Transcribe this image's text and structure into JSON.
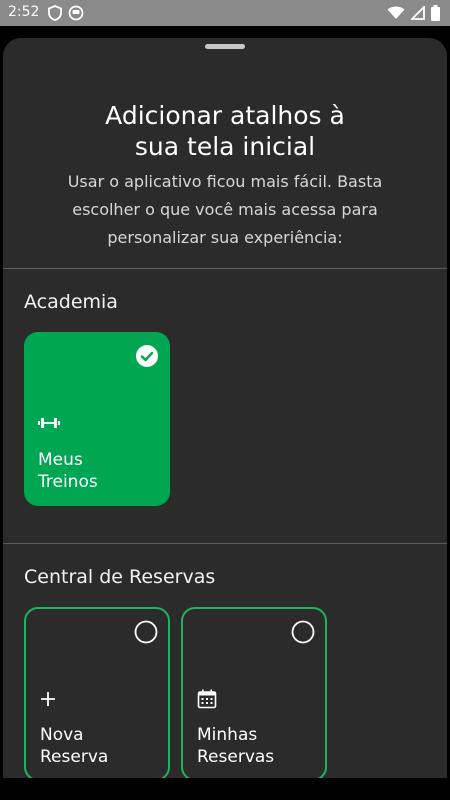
{
  "status_bar": {
    "time": "2:52",
    "left_icons": [
      "shield-icon",
      "circle-face-icon"
    ],
    "right_icons": [
      "wifi-icon",
      "signal-icon",
      "battery-icon"
    ]
  },
  "sheet": {
    "title_line1": "Adicionar atalhos à",
    "title_line2": "sua tela inicial",
    "subtitle_line1": "Usar o aplicativo ficou mais fácil. Basta",
    "subtitle_line2": "escolher o que você mais acessa para",
    "subtitle_line3": "personalizar sua experiência:"
  },
  "sections": [
    {
      "title": "Academia",
      "cards": [
        {
          "label_line1": "Meus",
          "label_line2": "Treinos",
          "icon": "dumbbell-icon",
          "selected": true
        }
      ]
    },
    {
      "title": "Central de Reservas",
      "cards": [
        {
          "label_line1": "Nova",
          "label_line2": "Reserva",
          "icon": "plus-icon",
          "selected": false
        },
        {
          "label_line1": "Minhas",
          "label_line2": "Reservas",
          "icon": "calendar-icon",
          "selected": false
        }
      ]
    }
  ],
  "colors": {
    "accent": "#00a651",
    "sheet_background": "#2b2b2b",
    "status_bar": "#8a8a8a"
  }
}
